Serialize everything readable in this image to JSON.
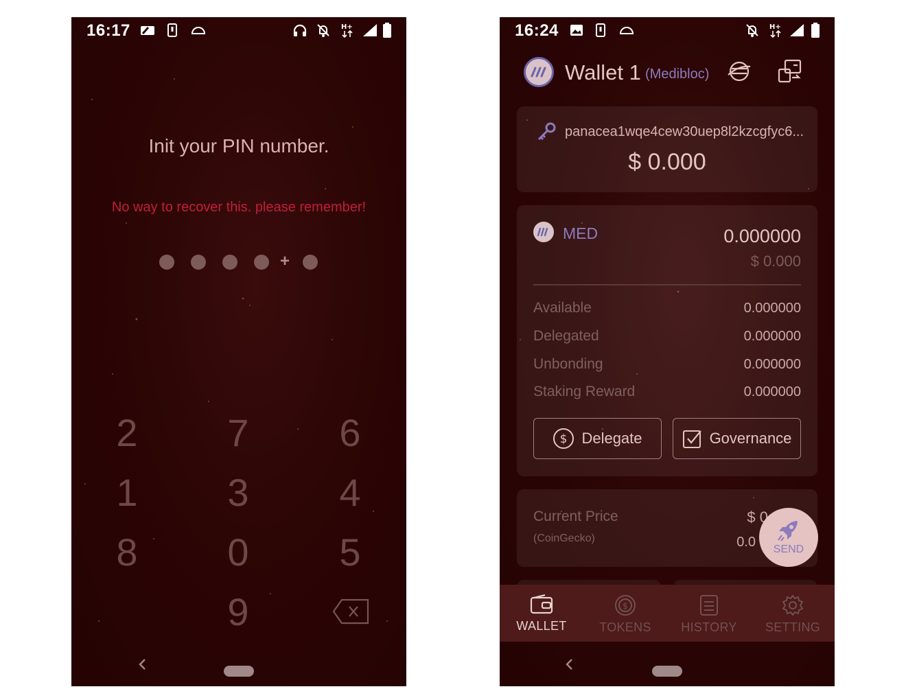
{
  "left_screen": {
    "status": {
      "time": "16:17"
    },
    "title": "Init your PIN number.",
    "warning": "No way to recover this. please remember!",
    "pin_plus": "+",
    "keypad": [
      "2",
      "7",
      "6",
      "1",
      "3",
      "4",
      "8",
      "0",
      "5",
      "9"
    ],
    "backspace_icon": "backspace-icon"
  },
  "right_screen": {
    "status": {
      "time": "16:24"
    },
    "wallet_name": "Wallet 1",
    "wallet_network": "(Medibloc)",
    "address": "panacea1wqe4cew30uep8l2kzcgfyc6...",
    "address_balance": "$ 0.000",
    "token": {
      "name": "MED",
      "amount": "0.000000",
      "usd": "$ 0.000",
      "rows": [
        {
          "label": "Available",
          "value": "0.000000"
        },
        {
          "label": "Delegated",
          "value": "0.000000"
        },
        {
          "label": "Unbonding",
          "value": "0.000000"
        },
        {
          "label": "Staking Reward",
          "value": "0.000000"
        }
      ],
      "delegate_label": "Delegate",
      "governance_label": "Governance"
    },
    "price": {
      "label": "Current Price",
      "source": "(CoinGecko)",
      "usd_partial": "$ 0",
      "value_partial": "0.0"
    },
    "send_label": "SEND",
    "tabs": [
      {
        "label": "WALLET",
        "icon": "wallet-icon",
        "active": true
      },
      {
        "label": "TOKENS",
        "icon": "coin-icon",
        "active": false
      },
      {
        "label": "HISTORY",
        "icon": "list-icon",
        "active": false
      },
      {
        "label": "SETTING",
        "icon": "gear-icon",
        "active": false
      }
    ]
  },
  "colors": {
    "background": "#2c0505",
    "warning": "#c11f3a",
    "accent_purple": "#8c7bbd",
    "tabbar": "#4e1a1a"
  }
}
